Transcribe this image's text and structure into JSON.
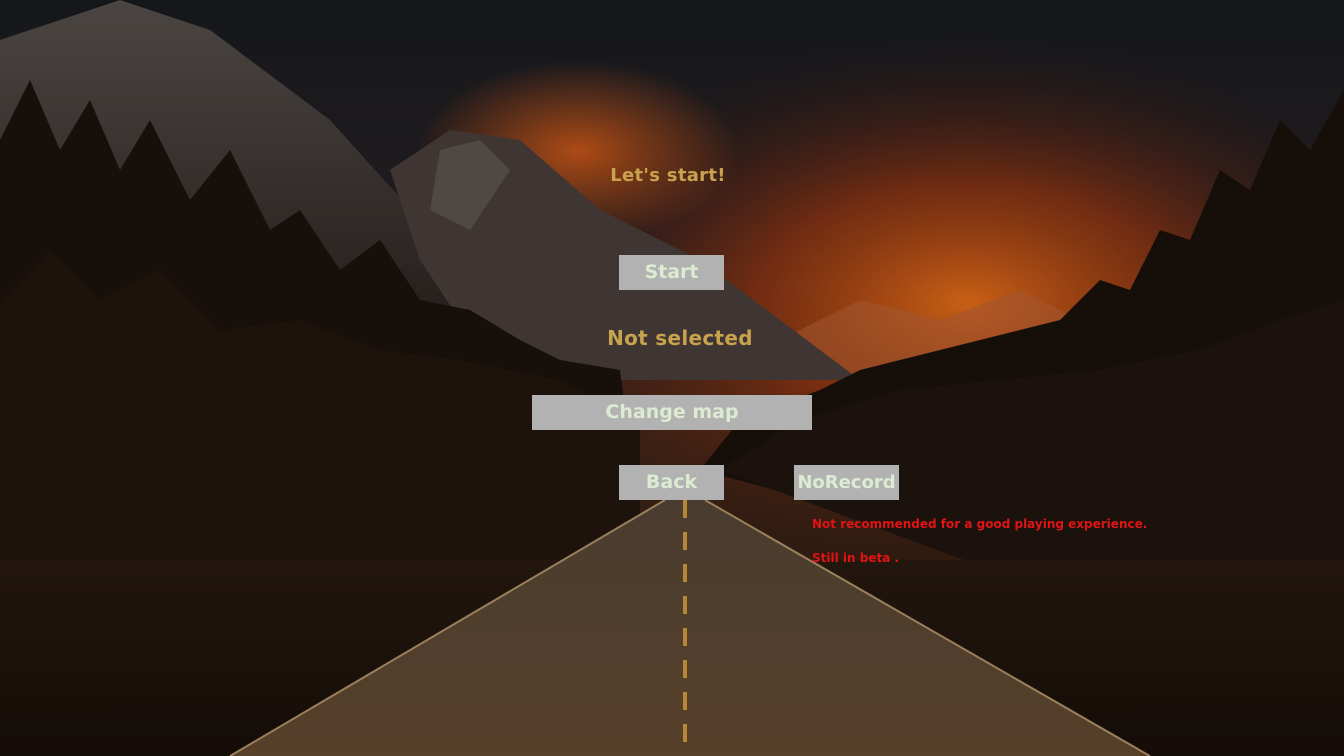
{
  "menu": {
    "heading": "Let's start!",
    "start_label": "Start",
    "map_status": "Not selected",
    "change_map_label": "Change map",
    "back_label": "Back",
    "norecord_label": "NoRecord",
    "warning_line_1": "Not recommended for a good playing experience.",
    "warning_line_2": "Still in beta ."
  },
  "colors": {
    "heading_text": "#c9a24e",
    "button_bg": "#b2b2b2",
    "button_text": "#dcebd1",
    "warning_text": "#e11414"
  }
}
